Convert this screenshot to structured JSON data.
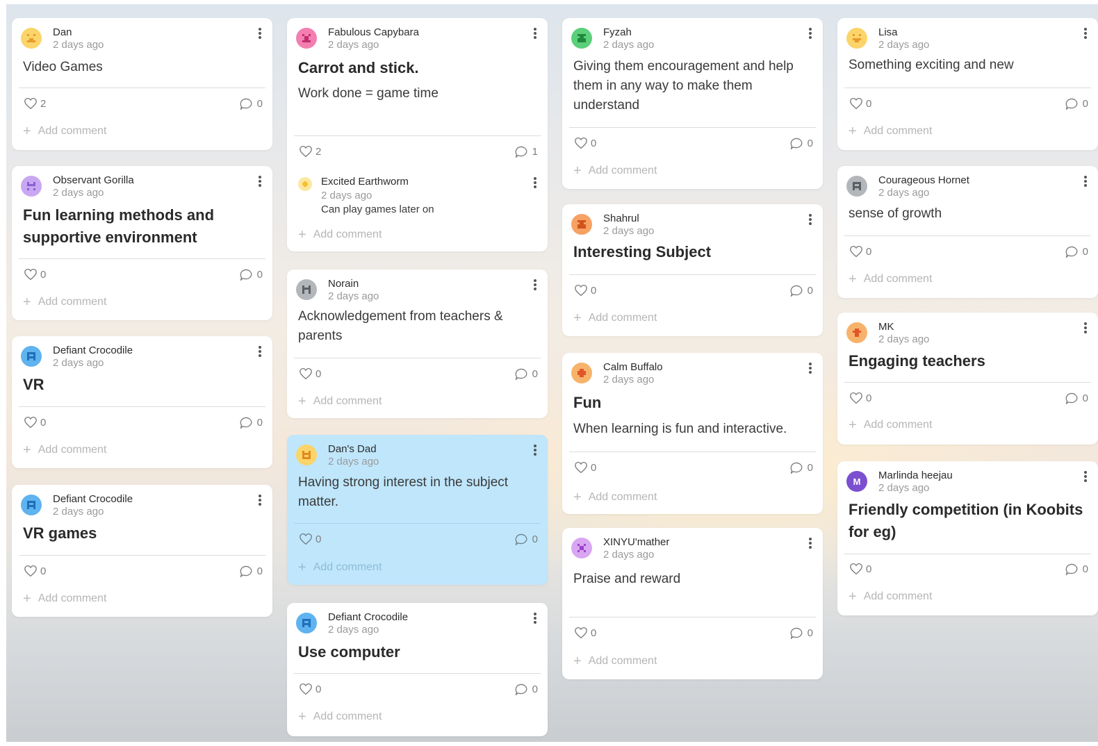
{
  "ui": {
    "add_comment": "Add comment"
  },
  "columns": [
    {
      "cards": [
        {
          "author": "Dan",
          "time": "2 days ago",
          "body": "Video Games",
          "likes": "2",
          "comments": "0",
          "avatar_color": "#fbd46a"
        },
        {
          "author": "Observant Gorilla",
          "time": "2 days ago",
          "title": "Fun learning methods and supportive environment",
          "likes": "0",
          "comments": "0",
          "avatar_color": "#c9a7f2"
        },
        {
          "author": "Defiant Crocodile",
          "time": "2 days ago",
          "title": "VR",
          "likes": "0",
          "comments": "0",
          "avatar_color": "#5fb3ef"
        },
        {
          "author": "Defiant Crocodile",
          "time": "2 days ago",
          "title": "VR games",
          "likes": "0",
          "comments": "0",
          "avatar_color": "#5fb3ef"
        }
      ]
    },
    {
      "cards": [
        {
          "author": "Fabulous Capybara",
          "time": "2 days ago",
          "title": "Carrot and stick.",
          "body": "Work done = game time",
          "likes": "2",
          "comments": "1",
          "avatar_color": "#f27fb0",
          "reply": {
            "author": "Excited Earthworm",
            "time": "2 days ago",
            "text": "Can play games later on"
          }
        },
        {
          "author": "Norain",
          "time": "2 days ago",
          "body": "Acknowledgement from teachers & parents",
          "likes": "0",
          "comments": "0",
          "avatar_color": "#b3b7bb"
        },
        {
          "author": "Dan's Dad",
          "time": "2 days ago",
          "body": "Having strong interest in the subject matter.",
          "likes": "0",
          "comments": "0",
          "avatar_color": "#fbd46a"
        },
        {
          "author": "Defiant Crocodile",
          "time": "2 days ago",
          "title": "Use computer",
          "likes": "0",
          "comments": "0",
          "avatar_color": "#5fb3ef"
        }
      ]
    },
    {
      "cards": [
        {
          "author": "Fyzah",
          "time": "2 days ago",
          "body": "Giving them encouragement and help them in any way to make them understand",
          "likes": "0",
          "comments": "0",
          "avatar_color": "#5ccf7a"
        },
        {
          "author": "Shahrul",
          "time": "2 days ago",
          "title": "Interesting Subject",
          "likes": "0",
          "comments": "0",
          "avatar_color": "#f7a163"
        },
        {
          "author": "Calm Buffalo",
          "time": "2 days ago",
          "title": "Fun",
          "body": "When learning is fun and interactive.",
          "likes": "0",
          "comments": "0",
          "avatar_color": "#f7b36b"
        },
        {
          "author": "XINYU'mather",
          "time": "2 days ago",
          "body": "Praise and reward",
          "likes": "0",
          "comments": "0",
          "avatar_color": "#d9a7f2"
        }
      ]
    },
    {
      "cards": [
        {
          "author": "Lisa",
          "time": "2 days ago",
          "body": "Something exciting and new",
          "likes": "0",
          "comments": "0",
          "avatar_color": "#fbd46a"
        },
        {
          "author": "Courageous Hornet",
          "time": "2 days ago",
          "body": "sense of growth",
          "likes": "0",
          "comments": "0",
          "avatar_color": "#b3b7bb"
        },
        {
          "author": "MK",
          "time": "2 days ago",
          "title": "Engaging teachers",
          "likes": "0",
          "comments": "0",
          "avatar_color": "#f7b36b"
        },
        {
          "author": "Marlinda heejau",
          "time": "2 days ago",
          "title": "Friendly competition (in Koobits for eg)",
          "likes": "0",
          "comments": "0",
          "avatar_color": "#7b4fd0",
          "avatar_letter": "M"
        }
      ]
    }
  ]
}
